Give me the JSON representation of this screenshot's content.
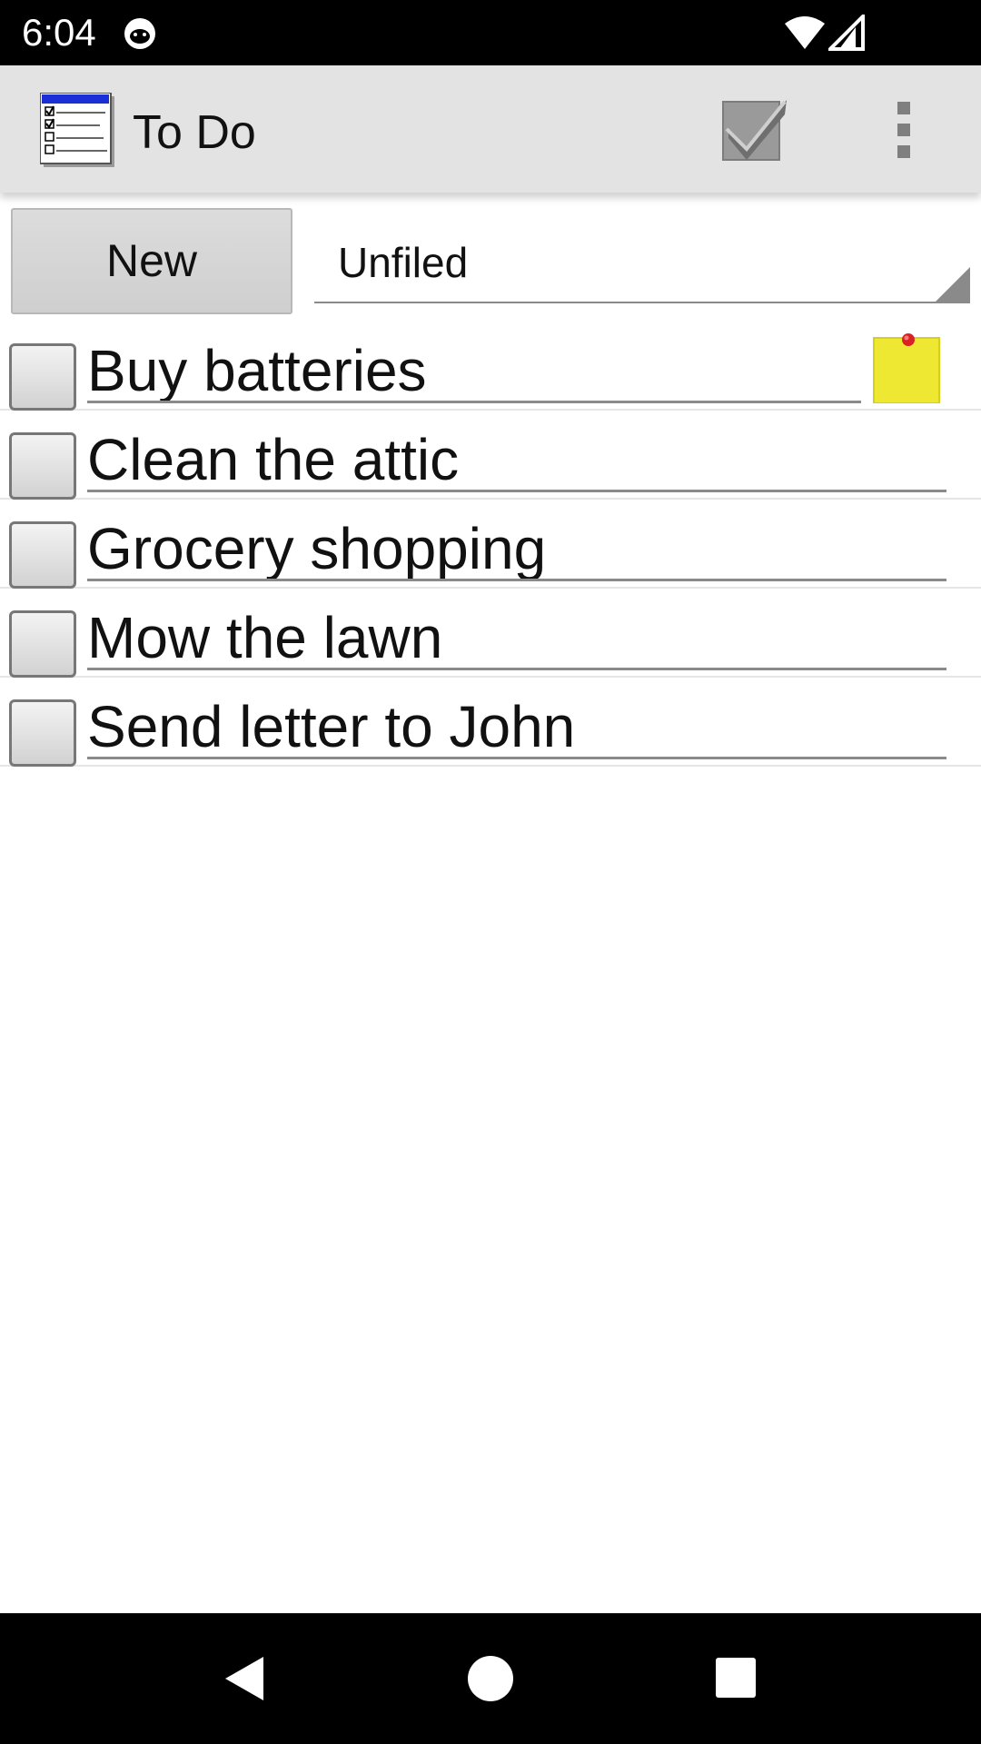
{
  "status_bar": {
    "time": "6:04",
    "icons": [
      "cat-notification-icon",
      "wifi-icon",
      "cell-signal-icon"
    ]
  },
  "app_bar": {
    "title": "To Do",
    "app_icon": "todo-app-icon",
    "actions": [
      "checkmark-icon",
      "overflow-menu-icon"
    ]
  },
  "controls": {
    "new_label": "New",
    "category_selected": "Unfiled"
  },
  "todos": [
    {
      "text": "Buy batteries",
      "checked": false,
      "has_note": true
    },
    {
      "text": "Clean the attic",
      "checked": false,
      "has_note": false
    },
    {
      "text": "Grocery shopping",
      "checked": false,
      "has_note": false
    },
    {
      "text": "Mow the lawn",
      "checked": false,
      "has_note": false
    },
    {
      "text": "Send letter to John",
      "checked": false,
      "has_note": false
    }
  ],
  "nav_bar": {
    "icons": [
      "back-icon",
      "home-icon",
      "recents-icon"
    ]
  },
  "colors": {
    "status_bar": "#000000",
    "app_bar": "#e3e3e3",
    "note": "#efe832",
    "nav_bar": "#000000"
  }
}
